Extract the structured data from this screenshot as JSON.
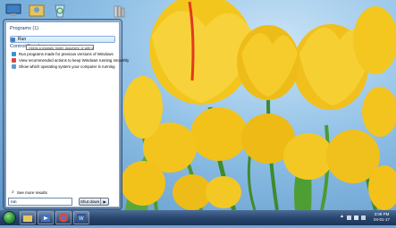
{
  "start_menu": {
    "programs_header": "Programs (1)",
    "programs": [
      {
        "label": "Run",
        "icon": "run-icon"
      }
    ],
    "tooltip": "Opens a program, folder, document, or web site.",
    "control_panel_header": "Control Panel",
    "control_panel_items": [
      {
        "label": "Run programs made for previous versions of Windows",
        "icon": "compat-icon"
      },
      {
        "label": "View recommended actions to keep Windows running smoothly",
        "icon": "flag-icon"
      },
      {
        "label": "Show which operating system your computer is running",
        "icon": "system-icon"
      }
    ],
    "see_more": "See more results",
    "search_value": "run",
    "shutdown_label": "Shut down",
    "shutdown_arrow": "▶"
  },
  "taskbar": {
    "time": "3:08 PM",
    "date": "04-01-17"
  },
  "colors": {
    "sky": "#8fc0e6",
    "tulip": "#f2c21a",
    "taskbar": "#2a4670"
  }
}
